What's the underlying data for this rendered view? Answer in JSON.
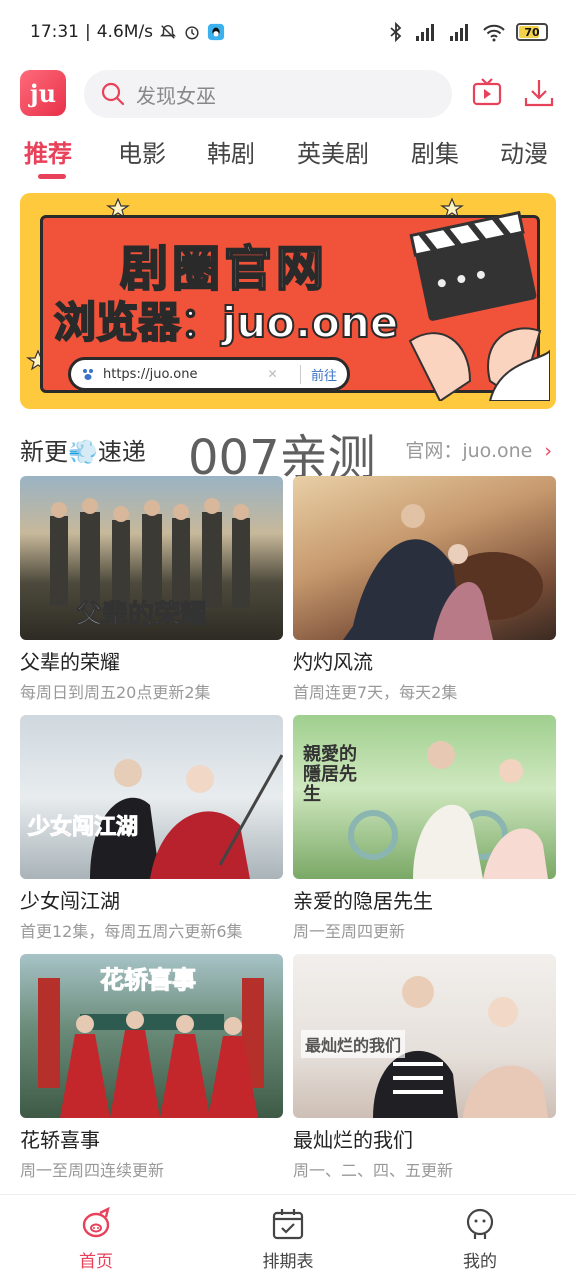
{
  "status_bar": {
    "time": "17:31",
    "separator": "|",
    "net_speed": "4.6M/s",
    "battery_level": "70",
    "icons": [
      "mute-bell-icon",
      "alarm-icon",
      "qq-icon",
      "bluetooth-icon",
      "signal-icon",
      "wifi-icon",
      "battery-icon"
    ]
  },
  "header": {
    "logo_text": "ju",
    "search_placeholder": "发现女巫",
    "icons": [
      "tv-icon",
      "download-icon"
    ]
  },
  "tabs": [
    {
      "label": "推荐",
      "active": true
    },
    {
      "label": "电影",
      "active": false
    },
    {
      "label": "韩剧",
      "active": false
    },
    {
      "label": "英美剧",
      "active": false
    },
    {
      "label": "剧集",
      "active": false
    },
    {
      "label": "动漫",
      "active": false
    }
  ],
  "banner": {
    "title": "剧圈官网",
    "subtitle": "浏览器：juo.one",
    "url": "https://juo.one",
    "go_label": "前往"
  },
  "section": {
    "title": "新更💨速递",
    "watermark": "007亲测",
    "link": "官网：juo.one",
    "chevron": "›"
  },
  "cards": [
    {
      "title": "父辈的荣耀",
      "subtitle": "每周日到周五20点更新2集",
      "poster_text": "父辈的荣耀"
    },
    {
      "title": "灼灼风流",
      "subtitle": "首周连更7天，每天2集",
      "poster_text": ""
    },
    {
      "title": "少女闯江湖",
      "subtitle": "首更12集，每周五周六更新6集",
      "poster_text": "少女闯江湖"
    },
    {
      "title": "亲爱的隐居先生",
      "subtitle": "周一至周四更新",
      "poster_text": "親愛的隱居先生"
    },
    {
      "title": "花轿喜事",
      "subtitle": "周一至周四连续更新",
      "poster_text": "花轿喜事"
    },
    {
      "title": "最灿烂的我们",
      "subtitle": "周一、二、四、五更新",
      "poster_text": "最灿烂的我们"
    }
  ],
  "bottom_nav": [
    {
      "label": "首页",
      "icon": "home-pig-icon",
      "active": true
    },
    {
      "label": "排期表",
      "icon": "calendar-icon",
      "active": false
    },
    {
      "label": "我的",
      "icon": "profile-icon",
      "active": false
    }
  ],
  "colors": {
    "accent": "#e8415a",
    "banner_bg": "#ffc93d",
    "banner_red": "#f0523a"
  }
}
